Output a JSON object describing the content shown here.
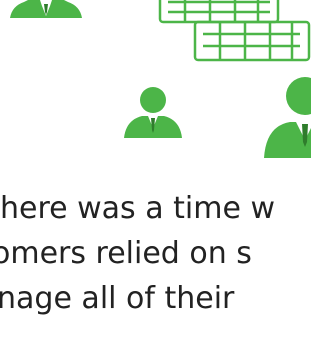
{
  "colors": {
    "accent_green": "#4cb548",
    "text": "#222222",
    "background": "#ffffff"
  },
  "illustration": {
    "icons": [
      "person-icon",
      "person-icon",
      "person-icon",
      "spreadsheet-icon"
    ]
  },
  "body_text": {
    "line_1": "here was a time w",
    "line_2": "omers relied on s",
    "line_3": "nage all of their"
  }
}
